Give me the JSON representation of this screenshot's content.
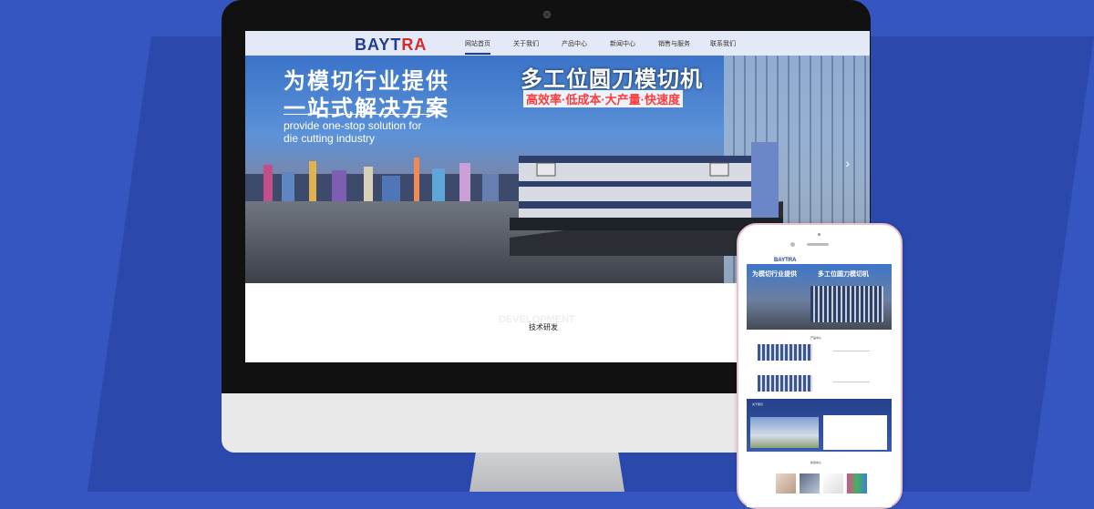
{
  "site": {
    "logo_main": "BAYT",
    "logo_accent": "RA",
    "nav": [
      "网站首页",
      "关于我们",
      "产品中心",
      "新闻中心",
      "销售与服务",
      "联系我们"
    ],
    "active_nav": "网站首页"
  },
  "banner": {
    "headline_cn_line1": "为模切行业提供",
    "headline_cn_line2": "一站式解决方案",
    "headline_en_line1": "provide one-stop solution for",
    "headline_en_line2": "die cutting industry",
    "product_title": "多工位圆刀模切机",
    "product_subtitle": "高效率·低成本·大产量·快速度",
    "next_arrow": "›"
  },
  "section": {
    "title_en": "DEVELOPMENT",
    "title_cn": "技术研发"
  },
  "phone": {
    "logo": "BAYTRA",
    "banner_cn_line1": "为模切行业提供",
    "banner_cn_line2": "多工位圆刀模切机",
    "products_label": "产品中心",
    "about_label": "关于我们",
    "news_label": "新闻中心"
  },
  "colors": {
    "background": "#3556c0",
    "brand_blue": "#1f3c92",
    "brand_red": "#d42b2b",
    "tagline_red": "#ff3b3b"
  }
}
